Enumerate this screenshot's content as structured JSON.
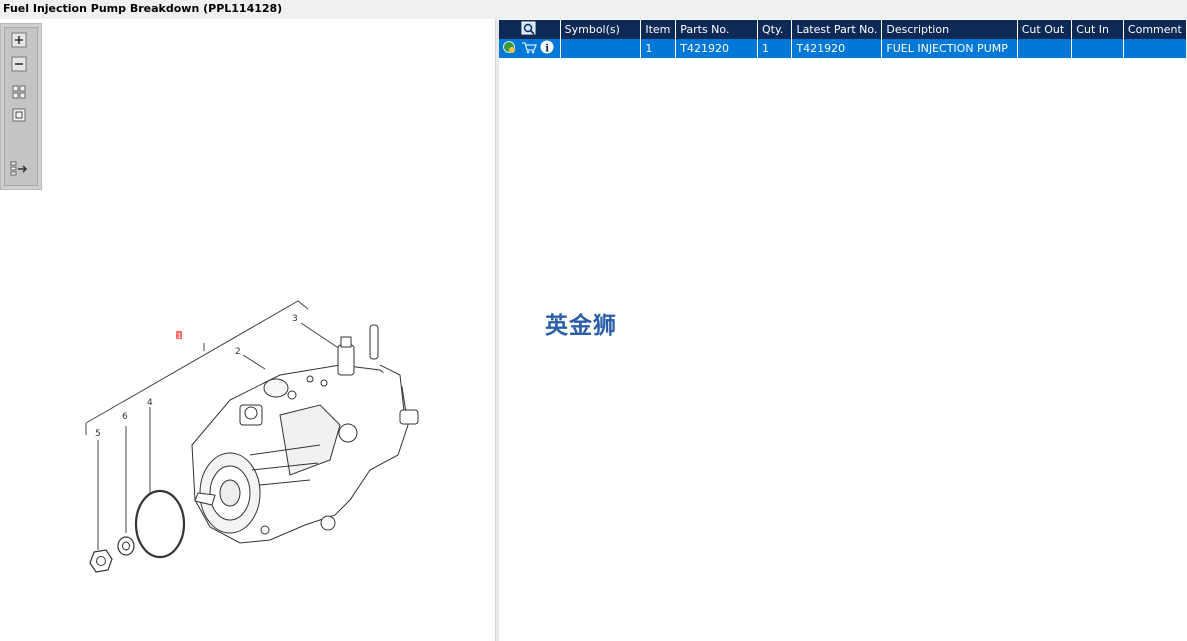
{
  "window": {
    "title": "Fuel Injection Pump Breakdown (PPL114128)"
  },
  "toolbar": {
    "buttons": [
      {
        "icon": "zoom-in-icon"
      },
      {
        "icon": "zoom-out-icon"
      },
      {
        "icon": "fit-all-icon"
      },
      {
        "icon": "fit-window-icon"
      },
      {
        "icon": "export-list-icon"
      }
    ]
  },
  "diagram": {
    "callouts": [
      "1",
      "2",
      "3",
      "4",
      "5",
      "6"
    ]
  },
  "table": {
    "columns": [
      "",
      "Symbol(s)",
      "Item",
      "Parts No.",
      "Qty.",
      "Latest Part No.",
      "Description",
      "Cut Out",
      "Cut In",
      "Comment"
    ],
    "rows": [
      {
        "symbols": "",
        "item": "1",
        "parts_no": "T421920",
        "qty": "1",
        "latest_part_no": "T421920",
        "description": "FUEL INJECTION PUMP",
        "cut_out": "",
        "cut_in": "",
        "comment": ""
      }
    ],
    "header_color": "#0d2a57",
    "selected_color": "#0078d7"
  },
  "watermark": {
    "text": "英金狮"
  }
}
